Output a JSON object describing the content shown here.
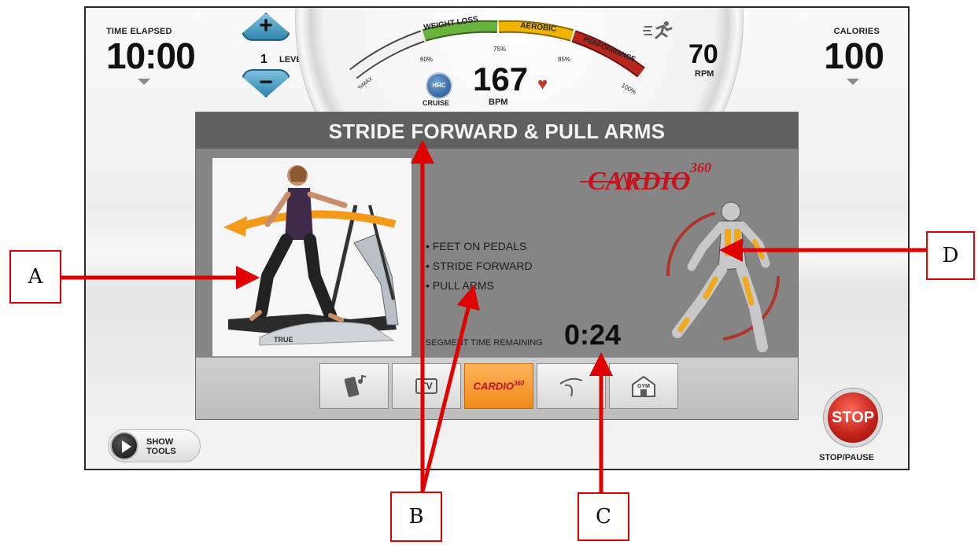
{
  "console": {
    "time_label": "TIME ELAPSED",
    "time_value": "10:00",
    "level_value": "1",
    "level_label": "LEVEL",
    "level_up_icon": "+",
    "level_down_icon": "−",
    "gauge": {
      "zones": [
        "WEIGHT LOSS",
        "AEROBIC",
        "PERFORMANCE"
      ],
      "ticks": [
        "%MAX",
        "60%",
        "75%",
        "85%",
        "100%"
      ],
      "zone_colors": [
        "#5aa03a",
        "#f0b400",
        "#b7261c"
      ]
    },
    "hrc_icon_text": "HRC",
    "cruise_label": "CRUISE",
    "bpm_value": "167",
    "bpm_label": "BPM",
    "heart_icon": "♥",
    "rpm_value": "70",
    "rpm_label": "RPM",
    "calories_label": "CALORIES",
    "calories_value": "100"
  },
  "panel": {
    "title": "STRIDE FORWARD & PULL ARMS",
    "instructions": [
      "• FEET ON PEDALS",
      "• STRIDE FORWARD",
      "• PULL ARMS"
    ],
    "segment_label": "SEGMENT TIME REMAINING",
    "segment_time": "0:24",
    "brand_logo": "CARDIO",
    "brand_logo_sup": "360",
    "machine_brand": "TRUE",
    "tray": {
      "tv_label": "TV",
      "brand_label": "CARDIO",
      "brand_sup": "360",
      "gym_label": "GYM",
      "active_index": 2
    }
  },
  "controls": {
    "show_tools": [
      "SHOW",
      "TOOLS"
    ],
    "stop_label": "STOP",
    "stop_pause_label": "STOP/PAUSE"
  },
  "annotations": {
    "labels": [
      "A",
      "B",
      "C",
      "D"
    ],
    "color": "#e00000"
  }
}
